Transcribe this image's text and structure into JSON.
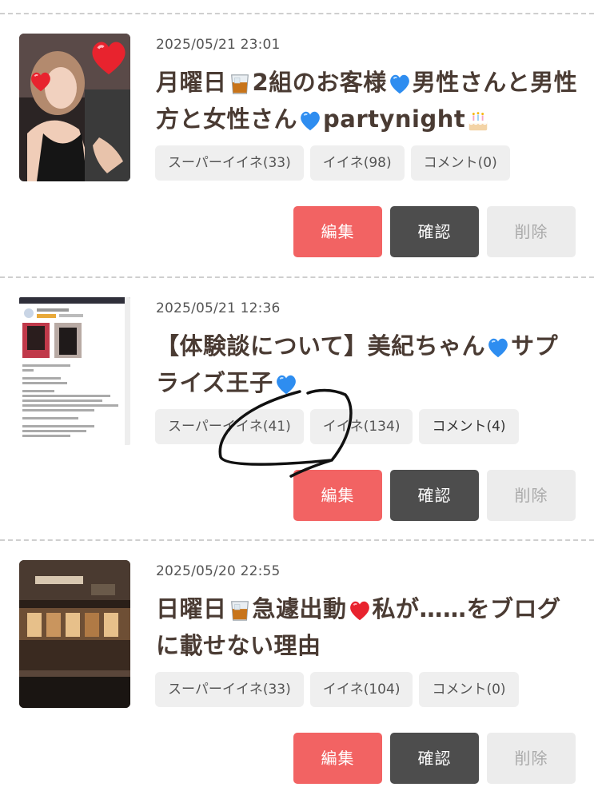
{
  "posts": [
    {
      "date": "2025/05/21 23:01",
      "title_parts": [
        "月曜日",
        "2組のお客様",
        "男性さんと男性方と女性さん",
        "partynight"
      ],
      "tags": {
        "super_like": "スーパーイイネ(33)",
        "like": "イイネ(98)",
        "comment": "コメント(0)"
      },
      "buttons": {
        "edit": "編集",
        "confirm": "確認",
        "delete": "削除"
      }
    },
    {
      "date": "2025/05/21 12:36",
      "title_parts": [
        "【体験談について】美紀ちゃん",
        "サプライズ王子"
      ],
      "tags": {
        "super_like": "スーパーイイネ(41)",
        "like": "イイネ(134)",
        "comment": "コメント(4)"
      },
      "buttons": {
        "edit": "編集",
        "confirm": "確認",
        "delete": "削除"
      }
    },
    {
      "date": "2025/05/20 22:55",
      "title_parts": [
        "日曜日",
        "急遽出動",
        "私が……をブログに載せない理由"
      ],
      "tags": {
        "super_like": "スーパーイイネ(33)",
        "like": "イイネ(104)",
        "comment": "コメント(0)"
      },
      "buttons": {
        "edit": "編集",
        "confirm": "確認",
        "delete": "削除"
      }
    }
  ],
  "icons": {
    "post1_thumbnail": "selfie-photo",
    "post2_thumbnail": "review-screenshot",
    "post3_thumbnail": "bar-interior-photo",
    "glass_emoji": "whisky-glass-icon",
    "blue_heart": "blue-heart-icon",
    "red_heart": "red-heart-icon",
    "cake": "birthday-cake-icon"
  },
  "colors": {
    "edit": "#f26363",
    "confirm": "#4d4d4d",
    "delete_bg": "#ececec",
    "title": "#4a3b33"
  }
}
